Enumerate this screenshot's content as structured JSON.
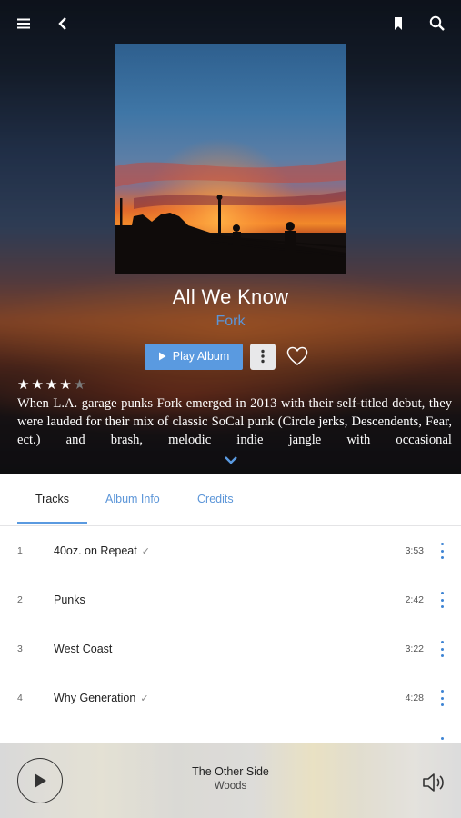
{
  "album": {
    "title": "All We Know",
    "artist": "Fork",
    "play_label": "Play Album",
    "rating": 4,
    "rating_max": 5,
    "description": "When L.A. garage punks Fork emerged in 2013 with their self-titled debut, they were lauded for their mix of classic SoCal punk (Circle jerks, Descendents, Fear, ect.) and brash, melodic indie jangle with occasional"
  },
  "tabs": [
    {
      "label": "Tracks",
      "active": true
    },
    {
      "label": "Album Info",
      "active": false
    },
    {
      "label": "Credits",
      "active": false
    }
  ],
  "tracks": [
    {
      "num": "1",
      "title": "40oz. on Repeat",
      "check": "✓",
      "duration": "3:53"
    },
    {
      "num": "2",
      "title": "Punks",
      "check": "",
      "duration": "2:42"
    },
    {
      "num": "3",
      "title": "West Coast",
      "check": "",
      "duration": "3:22"
    },
    {
      "num": "4",
      "title": "Why Generation",
      "check": "✓",
      "duration": "4:28"
    }
  ],
  "now_playing": {
    "title": "The Other Side",
    "artist": "Woods"
  },
  "icons": {
    "menu": "menu-icon",
    "back": "back-icon",
    "bookmark": "bookmark-icon",
    "search": "search-icon",
    "heart": "heart-icon",
    "more": "more-vertical-icon",
    "expand": "chevron-down-icon",
    "play": "play-icon",
    "volume": "volume-icon"
  },
  "colors": {
    "accent": "#5a9ae0",
    "link": "#5b95d8",
    "dots": "#3f84d4"
  }
}
